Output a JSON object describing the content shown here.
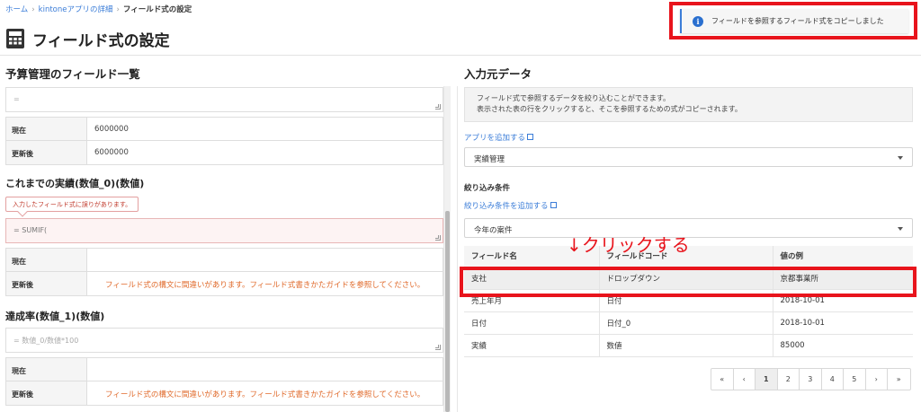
{
  "breadcrumb": {
    "home": "ホーム",
    "detail": "kintoneアプリの詳細",
    "current": "フィールド式の設定"
  },
  "page": {
    "title": "フィールド式の設定",
    "icon": "calculator-icon"
  },
  "toast": {
    "message": "フィールドを参照するフィールド式をコピーしました",
    "icon": "info-icon"
  },
  "left": {
    "heading": "予算管理のフィールド一覧",
    "block1": {
      "formula": "=",
      "rows": [
        {
          "label": "現在",
          "value": "6000000"
        },
        {
          "label": "更新後",
          "value": "6000000"
        }
      ]
    },
    "block2": {
      "heading": "これまでの実績(数値_0)(数値)",
      "error_tag": "入力したフィールド式に誤りがあります。",
      "formula": "= SUMIF(",
      "rows": [
        {
          "label": "現在",
          "value": ""
        },
        {
          "label": "更新後",
          "value": "フィールド式の構文に間違いがあります。フィールド式書きかたガイドを参照してください。"
        }
      ]
    },
    "block3": {
      "heading": "達成率(数値_1)(数値)",
      "formula": "= 数値_0/数値*100",
      "rows": [
        {
          "label": "現在",
          "value": ""
        },
        {
          "label": "更新後",
          "value": "フィールド式の構文に間違いがあります。フィールド式書きかたガイドを参照してください。"
        }
      ]
    }
  },
  "right": {
    "heading": "入力元データ",
    "desc_line1": "フィールド式で参照するデータを絞り込むことができます。",
    "desc_line2": "表示された表の行をクリックすると、そこを参照するための式がコピーされます。",
    "add_app_link": "アプリを追加する",
    "app_select": "実績管理",
    "filter_label": "絞り込み条件",
    "add_filter_link": "絞り込み条件を追加する",
    "filter_select": "今年の案件",
    "annotation": "↓クリックする",
    "table": {
      "headers": [
        "フィールド名",
        "フィールドコード",
        "値の例"
      ],
      "rows": [
        [
          "支社",
          "ドロップダウン",
          "京都事業所"
        ],
        [
          "売上年月",
          "日付",
          "2018-10-01"
        ],
        [
          "日付",
          "日付_0",
          "2018-10-01"
        ],
        [
          "実績",
          "数値",
          "85000"
        ]
      ]
    },
    "pager": {
      "first": "«",
      "prev": "‹",
      "pages": [
        "1",
        "2",
        "3",
        "4",
        "5"
      ],
      "next": "›",
      "last": "»",
      "active": "1"
    }
  },
  "colors": {
    "accent": "#3b7dd8",
    "highlight": "#e8141c",
    "error_text": "#e06a2b"
  }
}
